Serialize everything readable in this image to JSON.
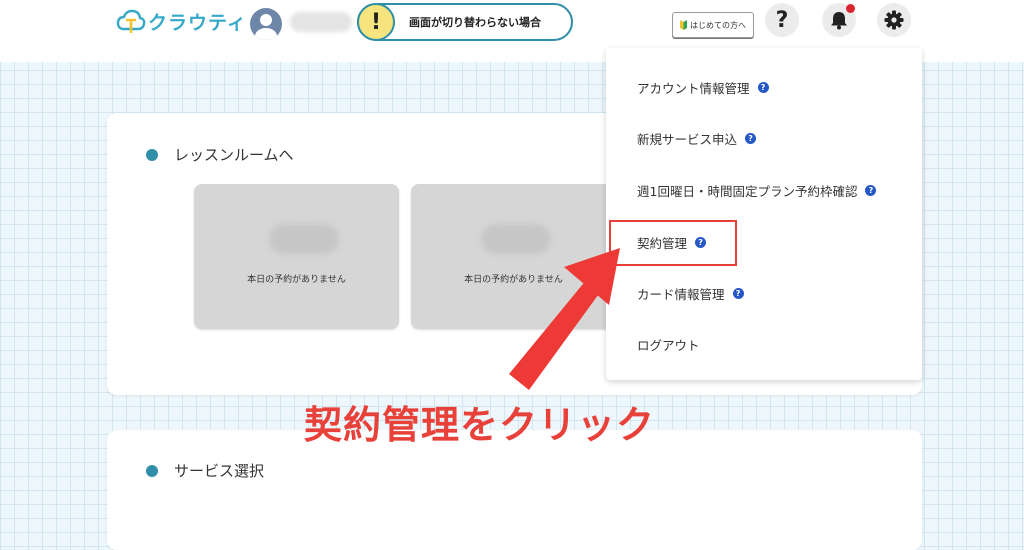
{
  "app": {
    "name": "クラウティ"
  },
  "header": {
    "notice_text": "画面が切り替わらない場合",
    "notice_icon_glyph": "!",
    "beginner_label": "はじめての方へ",
    "help_glyph": "?"
  },
  "lesson": {
    "title": "レッスンルームへ",
    "rooms": [
      {
        "status": "本日の予約がありません"
      },
      {
        "status": "本日の予約がありません"
      }
    ]
  },
  "service": {
    "title": "サービス選択"
  },
  "menu": {
    "items": [
      {
        "label": "アカウント情報管理",
        "help_glyph": "?"
      },
      {
        "label": "新規サービス申込",
        "help_glyph": "?"
      },
      {
        "label": "週1回曜日・時間固定プラン予約枠確認",
        "help_glyph": "?"
      },
      {
        "label": "契約管理",
        "help_glyph": "?"
      },
      {
        "label": "カード情報管理",
        "help_glyph": "?"
      },
      {
        "label": "ログアウト"
      }
    ]
  },
  "annotation": {
    "text": "契約管理をクリック"
  },
  "colors": {
    "accent": "#2f8fa6",
    "logo": "#37a9c8",
    "annotation": "#e8413a",
    "notification_dot": "#d9252f",
    "help_badge": "#2457c7"
  }
}
